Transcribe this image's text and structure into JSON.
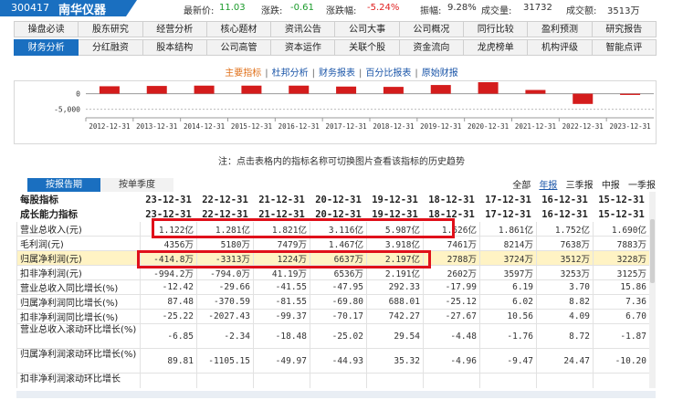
{
  "header": {
    "code": "300417",
    "name": "南华仪器",
    "latest_label": "最新价:",
    "latest": "11.03",
    "change_label": "涨跌:",
    "change": "-0.61",
    "pct_label": "涨跌幅:",
    "pct": "-5.24%",
    "amp_label": "振幅:",
    "amp": "9.28%",
    "vol_label": "成交量:",
    "vol": "31732",
    "amt_label": "成交额:",
    "amt": "3513万"
  },
  "tabs_row1": [
    "操盘必读",
    "股东研究",
    "经营分析",
    "核心题材",
    "资讯公告",
    "公司大事",
    "公司概况",
    "同行比较",
    "盈利预测",
    "研究报告"
  ],
  "tabs_row2": [
    "财务分析",
    "分红融资",
    "股本结构",
    "公司高管",
    "资本运作",
    "关联个股",
    "资金流向",
    "龙虎榜单",
    "机构评级",
    "智能点评"
  ],
  "subnav": [
    "主要指标",
    "杜邦分析",
    "财务报表",
    "百分比报表",
    "原始财报"
  ],
  "chart_data": {
    "type": "bar",
    "categories": [
      "2012-12-31",
      "2013-12-31",
      "2014-12-31",
      "2015-12-31",
      "2016-12-31",
      "2017-12-31",
      "2018-12-31",
      "2019-12-31",
      "2020-12-31",
      "2021-12-31",
      "2022-12-31",
      "2023-12-31"
    ],
    "values": [
      2400,
      2500,
      2600,
      2600,
      2600,
      2300,
      2200,
      2800,
      3700,
      1200,
      -3300,
      -400
    ],
    "ytick_labels": [
      "0",
      "-5,000"
    ],
    "yticks": [
      0,
      -5000
    ],
    "ylim": [
      -6000,
      4000
    ],
    "color": "#d41c1c"
  },
  "note": "注：点击表格内的指标名称可切换图片查看该指标的历史趋势",
  "period_tabs": [
    "按报告期",
    "按单季度"
  ],
  "report_filters": [
    "全部",
    "年报",
    "三季报",
    "中报",
    "一季报"
  ],
  "table": {
    "headers": [
      [
        "每股指标",
        "23-12-31",
        "22-12-31",
        "21-12-31",
        "20-12-31",
        "19-12-31",
        "18-12-31",
        "17-12-31",
        "16-12-31",
        "15-12-31"
      ],
      [
        "成长能力指标",
        "23-12-31",
        "22-12-31",
        "21-12-31",
        "20-12-31",
        "19-12-31",
        "18-12-31",
        "17-12-31",
        "16-12-31",
        "15-12-31"
      ]
    ],
    "rows": [
      [
        "营业总收入(元)",
        "1.122亿",
        "1.281亿",
        "1.821亿",
        "3.116亿",
        "5.987亿",
        "1.526亿",
        "1.861亿",
        "1.752亿",
        "1.690亿"
      ],
      [
        "毛利润(元)",
        "4356万",
        "5180万",
        "7479万",
        "1.467亿",
        "3.918亿",
        "7461万",
        "8214万",
        "7638万",
        "7883万"
      ],
      [
        "归属净利润(元)",
        "-414.8万",
        "-3313万",
        "1224万",
        "6637万",
        "2.197亿",
        "2788万",
        "3724万",
        "3512万",
        "3228万"
      ],
      [
        "扣非净利润(元)",
        "-994.2万",
        "-794.0万",
        "41.19万",
        "6536万",
        "2.191亿",
        "2602万",
        "3597万",
        "3253万",
        "3125万"
      ],
      [
        "营业总收入同比增长(%)",
        "-12.42",
        "-29.66",
        "-41.55",
        "-47.95",
        "292.33",
        "-17.99",
        "6.19",
        "3.70",
        "15.86"
      ],
      [
        "归属净利润同比增长(%)",
        "87.48",
        "-370.59",
        "-81.55",
        "-69.80",
        "688.01",
        "-25.12",
        "6.02",
        "8.82",
        "7.36"
      ],
      [
        "扣非净利润同比增长(%)",
        "-25.22",
        "-2027.43",
        "-99.37",
        "-70.17",
        "742.27",
        "-27.67",
        "10.56",
        "4.09",
        "6.70"
      ],
      [
        "营业总收入滚动环比增长(%)",
        "-6.85",
        "-2.34",
        "-18.48",
        "-25.02",
        "29.54",
        "-4.48",
        "-1.76",
        "8.72",
        "-1.87"
      ],
      [
        "归属净利润滚动环比增长(%)",
        "89.81",
        "-1105.15",
        "-49.97",
        "-44.93",
        "35.32",
        "-4.96",
        "-9.47",
        "24.47",
        "-10.20"
      ],
      [
        "扣非净利润滚动环比增长",
        "",
        "",
        "",
        "",
        "",
        "",
        "",
        "",
        ""
      ]
    ]
  }
}
